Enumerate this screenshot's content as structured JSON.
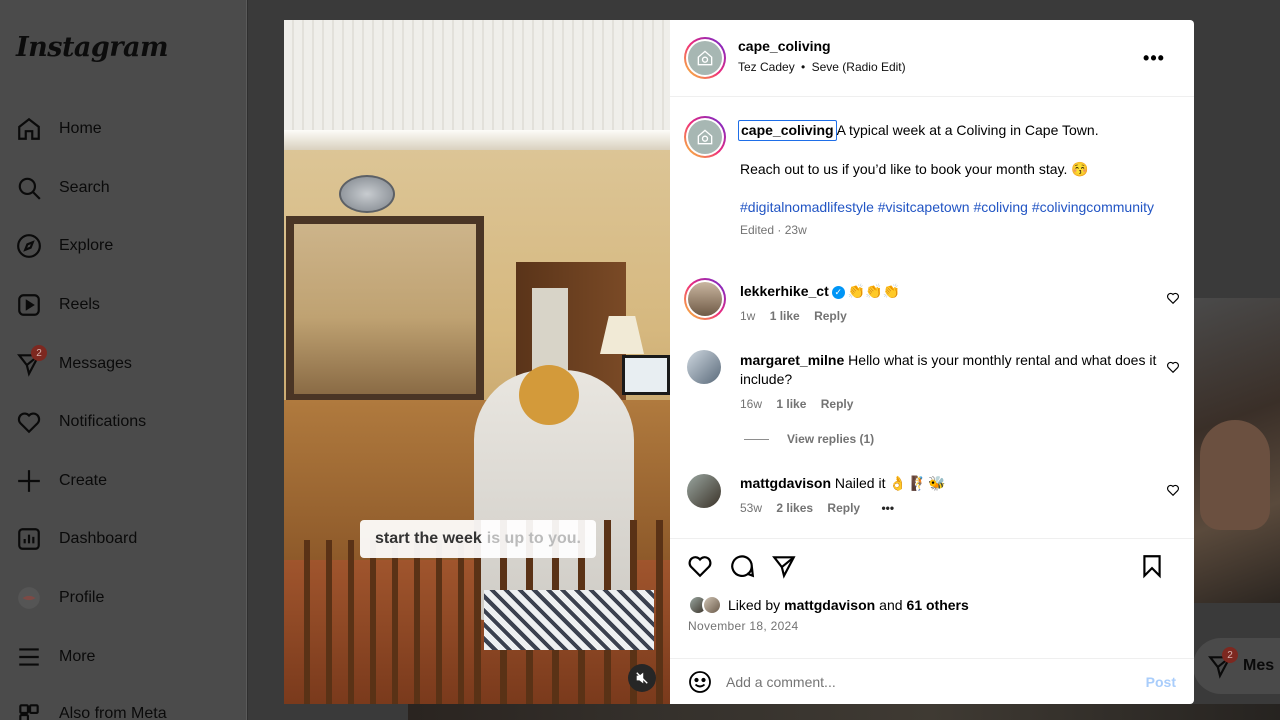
{
  "sidebar": {
    "logo": "Instagram",
    "items": [
      {
        "label": "Home",
        "icon": "home-icon"
      },
      {
        "label": "Search",
        "icon": "search-icon"
      },
      {
        "label": "Explore",
        "icon": "compass-icon"
      },
      {
        "label": "Reels",
        "icon": "reels-icon"
      },
      {
        "label": "Messages",
        "icon": "messenger-icon",
        "badge": "2"
      },
      {
        "label": "Notifications",
        "icon": "heart-icon"
      },
      {
        "label": "Create",
        "icon": "plus-icon"
      },
      {
        "label": "Dashboard",
        "icon": "dashboard-icon"
      },
      {
        "label": "Profile",
        "icon": "profile-avatar-icon"
      },
      {
        "label": "More",
        "icon": "menu-icon"
      },
      {
        "label": "Also from Meta",
        "icon": "meta-apps-icon"
      }
    ]
  },
  "video": {
    "caption_bright": "start the week",
    "caption_dim": "is up to you."
  },
  "post": {
    "username": "cape_coliving",
    "music_artist": "Tez Cadey",
    "music_separator": "•",
    "music_track": "Seve (Radio Edit)",
    "caption_username": "cape_coliving",
    "caption_text": "A typical week at a Coliving in Cape Town.",
    "caption_line2": "Reach out to us if you’d like to book your month stay. 😚",
    "hashtags": "#digitalnomadlifestyle #visitcapetown #coliving #colivingcommunity",
    "edited": "Edited",
    "edited_sep": "·",
    "edited_time": "23w"
  },
  "comments": [
    {
      "username": "lekkerhike_ct",
      "verified": true,
      "text": "👏👏👏",
      "time": "1w",
      "likes": "1 like",
      "reply": "Reply"
    },
    {
      "username": "margaret_milne",
      "verified": false,
      "text": "Hello what is your monthly rental and what does it include?",
      "time": "16w",
      "likes": "1 like",
      "reply": "Reply",
      "view_replies": "View replies (1)"
    },
    {
      "username": "mattgdavison",
      "verified": false,
      "text": "Nailed it 👌 🧗🐝",
      "time": "53w",
      "likes": "2 likes",
      "reply": "Reply",
      "more": "•••"
    }
  ],
  "engagement": {
    "liked_by_prefix": "Liked by",
    "liked_by_user": "mattgdavison",
    "and": "and",
    "others": "61 others",
    "date": "November 18, 2024"
  },
  "comment_box": {
    "placeholder": "Add a comment...",
    "post_label": "Post"
  },
  "floating_messages": {
    "label": "Mes",
    "badge": "2"
  },
  "colors": {
    "link_blue": "#2255c4",
    "post_disabled": "#a9cdfb",
    "verified_blue": "#0095f6"
  }
}
